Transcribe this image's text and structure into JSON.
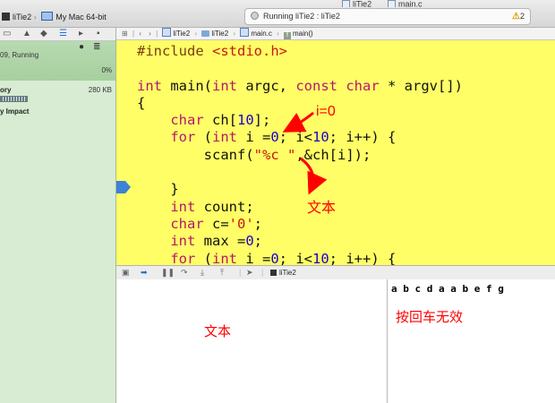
{
  "toolbar": {
    "tab_peek_1": "liTie2",
    "tab_peek_2": "main.c",
    "scheme_target": "liTie2",
    "scheme_device": "My Mac 64-bit",
    "activity_text": "Running liTie2 : liTie2",
    "warning_count": "2"
  },
  "navigator": {
    "process_status": "09, Running",
    "cpu_value": "0%",
    "memory_label": "ory",
    "memory_value": "280 KB",
    "memory_fill_percent": 100,
    "energy_label": "y Impact"
  },
  "jumpbar": {
    "crumbs": [
      "liTie2",
      "liTie2",
      "main.c",
      "main()"
    ]
  },
  "editor": {
    "line_1_directive": "#include",
    "line_1_header": "<stdio.h>",
    "annotations": {
      "loop_note": "i=0",
      "text_note": "文本"
    }
  },
  "debugbar": {
    "target": "liTie2"
  },
  "console": {
    "output": "a b c d a a b e f g",
    "note": "按回车无效"
  },
  "variables": {
    "note": "文本"
  },
  "colors": {
    "editor_background": "#fffe66",
    "annotation": "#ff0000",
    "keyword": "#b3186f",
    "number": "#1c00cf",
    "string": "#c41a16",
    "navigator_background": "#d7ecd2"
  }
}
